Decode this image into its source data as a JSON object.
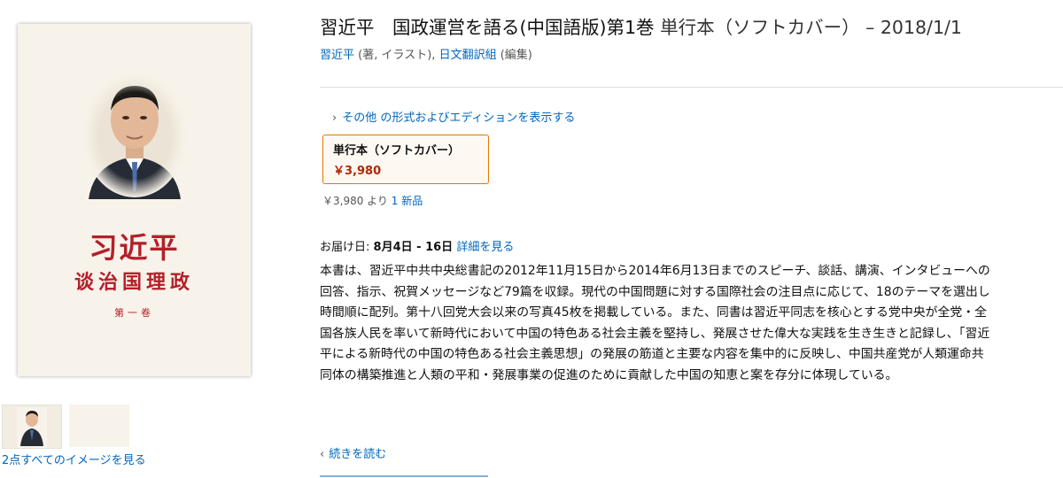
{
  "product": {
    "title_main": "習近平　国政運営を語る(中国語版)第1巻",
    "title_format": "単行本（ソフトカバー）",
    "title_date": "– 2018/1/1",
    "author_name": "習近平",
    "author_role": "(著, イラスト),",
    "editor_name": "日文翻訳組",
    "editor_role": "(編集)"
  },
  "cover": {
    "author": "习近平",
    "title": "谈治国理政",
    "volume": "第一卷"
  },
  "gallery": {
    "see_all_label": "2点すべてのイメージを見る"
  },
  "formats": {
    "other_formats_label": "その他 の形式およびエディションを表示する",
    "selected_name": "単行本（ソフトカバー）",
    "selected_price": "￥3,980",
    "new_price": "￥3,980 より",
    "new_count_link": "1 新品"
  },
  "delivery": {
    "label": "お届け日:",
    "dates": "8月4日 - 16日",
    "details_link": "詳細を見る"
  },
  "description": {
    "text": "本書は、習近平中共中央総書記の2012年11月15日から2014年6月13日までのスピーチ、談話、講演、インタビューへの回答、指示、祝賀メッセージなど79篇を収録。現代の中国問題に対する国際社会の注目点に応じて、18のテーマを選出し時間順に配列。第十八回党大会以来の写真45枚を掲載している。また、同書は習近平同志を核心とする党中央が全党・全国各族人民を率いて新時代において中国の特色ある社会主義を堅持し、発展させた偉大な実践を生き生きと記録し、「習近平による新時代の中国の特色ある社会主義思想」の発展の筋道と主要な内容を集中的に反映し、中国共産党が人類運命共同体の構築推進と人類の平和・発展事業の促進のために貢献した中国の知恵と案を存分に体現している。",
    "read_more_label": "続きを読む"
  },
  "colors": {
    "link": "#0066c0",
    "price": "#b12704",
    "selected_border": "#e77600",
    "cover_red": "#b3202a"
  }
}
